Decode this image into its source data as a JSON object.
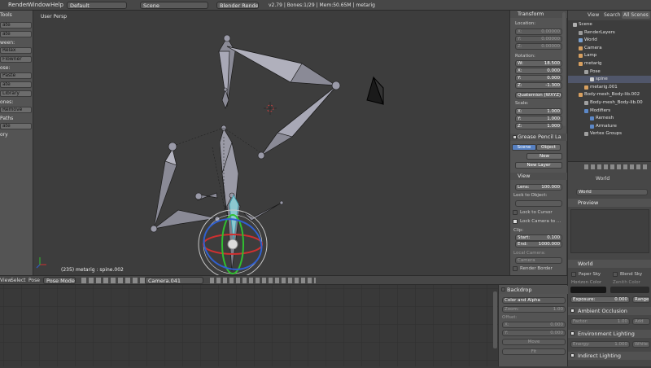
{
  "menu": {
    "render": "Render",
    "window": "Window",
    "help": "Help",
    "layout": "Default",
    "scene": "Scene",
    "engine": "Blender Render",
    "stats": "v2.79 | Bones:1/29 | Mem:50.65M | metarig"
  },
  "left_toolbar": {
    "title": "Tools",
    "items": [
      {
        "kind": "btn",
        "label": "ate"
      },
      {
        "kind": "btn",
        "label": "ate"
      },
      {
        "kind": "text",
        "label": "ween:"
      },
      {
        "kind": "btn",
        "label": "Relax"
      },
      {
        "kind": "btn",
        "label": "Flowner"
      },
      {
        "kind": "text",
        "label": "ose:"
      },
      {
        "kind": "btn",
        "label": "Paste"
      },
      {
        "kind": "btn",
        "label": "ate"
      },
      {
        "kind": "btn",
        "label": "Library"
      },
      {
        "kind": "text",
        "label": "ones:"
      },
      {
        "kind": "btn",
        "label": "Remove"
      },
      {
        "kind": "text",
        "label": "Paths"
      },
      {
        "kind": "btn",
        "label": "ate"
      },
      {
        "kind": "text",
        "label": "ory"
      }
    ]
  },
  "viewport": {
    "view_name": "User Persp",
    "status": "(235) metarig : spine.002"
  },
  "npanel": {
    "transform": "Transform",
    "location_label": "Location:",
    "location": [
      {
        "axis": "X:",
        "value": "0.00000"
      },
      {
        "axis": "Y:",
        "value": "0.00000"
      },
      {
        "axis": "Z:",
        "value": "0.00000"
      }
    ],
    "rotation_label": "Rotation:",
    "rotation": [
      {
        "axis": "W:",
        "value": "18.500"
      },
      {
        "axis": "X:",
        "value": "0.000"
      },
      {
        "axis": "Y:",
        "value": "0.000"
      },
      {
        "axis": "Z:",
        "value": "-1.300"
      }
    ],
    "rot_mode": "Quaternion (WXYZ)",
    "scale_label": "Scale:",
    "scale": [
      {
        "axis": "X:",
        "value": "1.000"
      },
      {
        "axis": "Y:",
        "value": "1.000"
      },
      {
        "axis": "Z:",
        "value": "1.000"
      }
    ],
    "grease": "Grease Pencil La",
    "gp_scene": "Scene",
    "gp_object": "Object",
    "gp_new": "New",
    "gp_newlayer": "New Layer",
    "view": "View",
    "lens_label": "Lens:",
    "lens_value": "100.000",
    "lock_object": "Lock to Object:",
    "lock_cursor": "Lock to Cursor",
    "lock_camera": "Lock Camera to ...",
    "clip": "Clip:",
    "clip_start_label": "Start:",
    "clip_start": "0.100",
    "clip_end_label": "End:",
    "clip_end": "1000.000",
    "local_camera": "Local Camera:",
    "camera_field": "Camera",
    "render_border": "Render Border"
  },
  "outliner": {
    "view": "View",
    "search": "Search",
    "all_scenes": "All Scenes",
    "rows": [
      {
        "label": "Scene",
        "indent": 0,
        "color": "#b0b0b0"
      },
      {
        "label": "RenderLayers",
        "indent": 1,
        "color": "#9c9c9c"
      },
      {
        "label": "World",
        "indent": 1,
        "color": "#7aa0d0"
      },
      {
        "label": "Camera",
        "indent": 1,
        "color": "#d8a060"
      },
      {
        "label": "Lamp",
        "indent": 1,
        "color": "#d8a060"
      },
      {
        "label": "metarig",
        "indent": 1,
        "color": "#d8a060"
      },
      {
        "label": "Pose",
        "indent": 2,
        "color": "#a0a0a0"
      },
      {
        "label": "spine",
        "indent": 3,
        "color": "#cfcfcf",
        "selected": true
      },
      {
        "label": "metarig.001",
        "indent": 2,
        "color": "#d8a060"
      },
      {
        "label": "Body-mesh_Body-lib.002",
        "indent": 1,
        "color": "#d8a060"
      },
      {
        "label": "Body-mesh_Body-lib.00",
        "indent": 2,
        "color": "#a0a0a0"
      },
      {
        "label": "Modifiers",
        "indent": 2,
        "color": "#5c88c8"
      },
      {
        "label": "Remesh",
        "indent": 3,
        "color": "#5c88c8"
      },
      {
        "label": "Armature",
        "indent": 3,
        "color": "#5c88c8"
      },
      {
        "label": "Vertex Groups",
        "indent": 2,
        "color": "#a0a0a0"
      }
    ]
  },
  "props": {
    "world_path": "World",
    "world_field": "World",
    "preview": "Preview",
    "world_panel": "World",
    "paper_sky": "Paper Sky",
    "blend_sky": "Blend Sky",
    "horizon": "Horizon Color",
    "zenith": "Zenith Color",
    "exposure_label": "Exposure:",
    "exposure": "0.000",
    "range": "Range",
    "ao": "Ambient Occlusion",
    "factor_label": "Factor:",
    "factor": "1.00",
    "add": "Add",
    "env": "Environment Lighting",
    "energy_label": "Energy:",
    "energy": "1.000",
    "white": "White",
    "indirect": "Indirect Lighting"
  },
  "vphdr": {
    "view": "View",
    "select": "Select",
    "pose": "Pose",
    "mode": "Pose Mode",
    "camera": "Camera.041"
  },
  "backdrop": {
    "title": "Backdrop",
    "mode": "Color and Alpha",
    "zoom_label": "Zoom:",
    "zoom": "1.00",
    "offset": "Offset:",
    "x_label": "X:",
    "x": "0.000",
    "y_label": "Y:",
    "y": "0.000",
    "move": "Move",
    "fit": "Fit"
  },
  "colors": {
    "accent": "#5680c2",
    "bg": "#3d3d3d",
    "panel": "#545454",
    "selected": "#50566a"
  }
}
